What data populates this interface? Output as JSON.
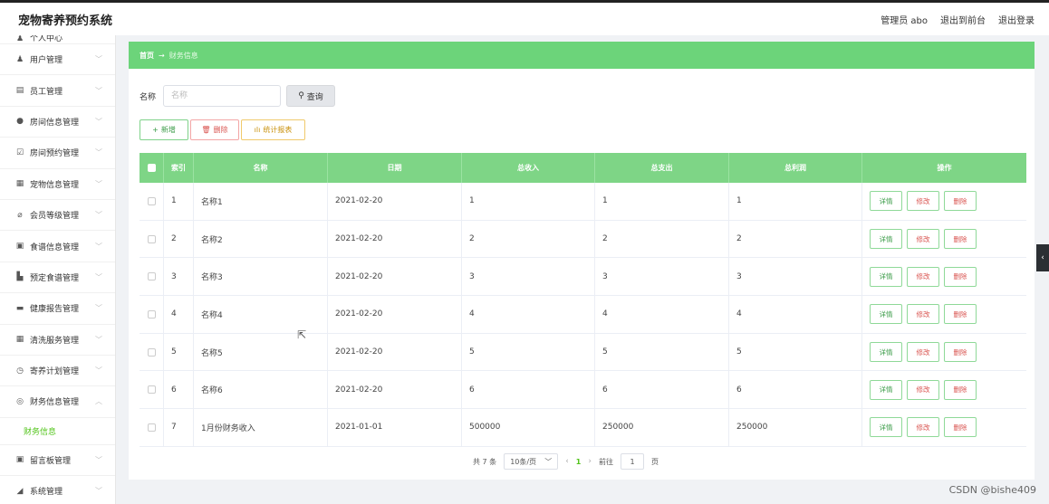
{
  "app": {
    "title": "宠物寄养预约系统"
  },
  "header": {
    "admin": "管理员 abo",
    "back_front": "退出到前台",
    "logout": "退出登录"
  },
  "sidebar": {
    "items": [
      {
        "label": "个人中心",
        "icon": "user-icon"
      },
      {
        "label": "用户管理",
        "icon": "user-icon"
      },
      {
        "label": "员工管理",
        "icon": "staff-icon"
      },
      {
        "label": "房间信息管理",
        "icon": "location-icon"
      },
      {
        "label": "房间预约管理",
        "icon": "calendar-icon"
      },
      {
        "label": "宠物信息管理",
        "icon": "pet-icon"
      },
      {
        "label": "会员等级管理",
        "icon": "level-icon"
      },
      {
        "label": "食谱信息管理",
        "icon": "recipe-icon"
      },
      {
        "label": "预定食谱管理",
        "icon": "chart-icon"
      },
      {
        "label": "健康报告管理",
        "icon": "report-icon"
      },
      {
        "label": "清洗服务管理",
        "icon": "grid-icon"
      },
      {
        "label": "寄养计划管理",
        "icon": "clock-icon"
      },
      {
        "label": "财务信息管理",
        "icon": "finance-icon"
      },
      {
        "label": "留言板管理",
        "icon": "message-icon"
      },
      {
        "label": "系统管理",
        "icon": "settings-icon"
      }
    ],
    "active_sub": "财务信息"
  },
  "breadcrumb": {
    "home": "首页",
    "arrow": "→",
    "current": "财务信息"
  },
  "search": {
    "label": "名称",
    "placeholder": "名称",
    "button": "查询"
  },
  "actions": {
    "add": "新增",
    "delete": "删除",
    "stats": "统计报表"
  },
  "table": {
    "headers": [
      "",
      "索引",
      "名称",
      "日期",
      "总收入",
      "总支出",
      "总利润",
      "操作"
    ],
    "rows": [
      {
        "idx": "1",
        "name": "名称1",
        "date": "2021-02-20",
        "income": "1",
        "expense": "1",
        "profit": "1"
      },
      {
        "idx": "2",
        "name": "名称2",
        "date": "2021-02-20",
        "income": "2",
        "expense": "2",
        "profit": "2"
      },
      {
        "idx": "3",
        "name": "名称3",
        "date": "2021-02-20",
        "income": "3",
        "expense": "3",
        "profit": "3"
      },
      {
        "idx": "4",
        "name": "名称4",
        "date": "2021-02-20",
        "income": "4",
        "expense": "4",
        "profit": "4"
      },
      {
        "idx": "5",
        "name": "名称5",
        "date": "2021-02-20",
        "income": "5",
        "expense": "5",
        "profit": "5"
      },
      {
        "idx": "6",
        "name": "名称6",
        "date": "2021-02-20",
        "income": "6",
        "expense": "6",
        "profit": "6"
      },
      {
        "idx": "7",
        "name": "1月份财务收入",
        "date": "2021-01-01",
        "income": "500000",
        "expense": "250000",
        "profit": "250000"
      }
    ],
    "ops": {
      "detail": "详情",
      "edit": "修改",
      "delete": "删除"
    }
  },
  "pager": {
    "total": "共 7 条",
    "size": "10条/页",
    "current": "1",
    "goto": "前往",
    "page_value": "1",
    "page_unit": "页"
  },
  "watermark": "CSDN @bishe409",
  "colors": {
    "accent": "#6cd47a",
    "header_row": "#7ed586",
    "danger": "#d9534f",
    "warning": "#c9910c"
  }
}
